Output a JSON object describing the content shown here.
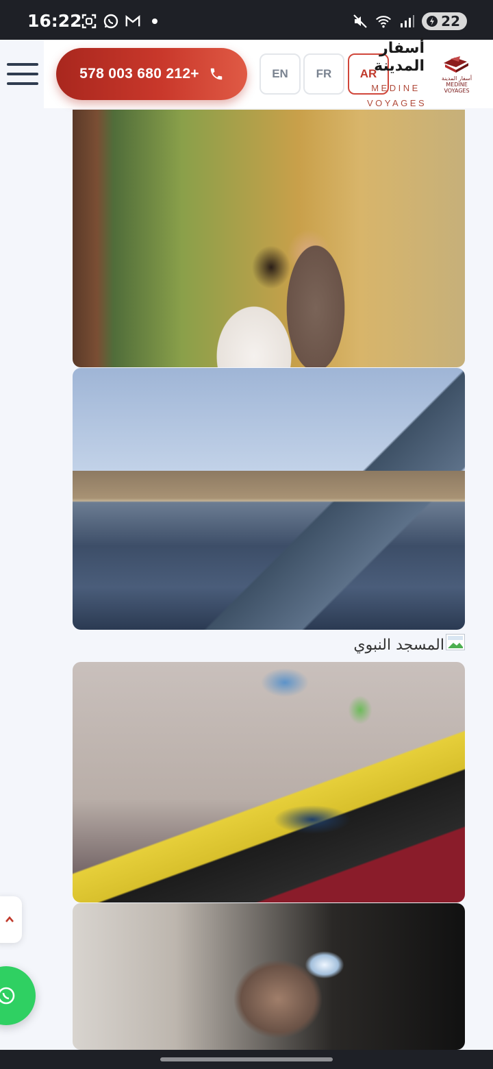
{
  "status_bar": {
    "time": "16:22",
    "battery": "22",
    "icons": [
      "screenshot-icon",
      "whatsapp-icon",
      "gmail-icon",
      "dot-icon",
      "mute-icon",
      "wifi-icon",
      "signal-icon",
      "battery-icon"
    ]
  },
  "header": {
    "phone_label": "578 003 680 212+",
    "languages": [
      {
        "code": "EN",
        "active": false
      },
      {
        "code": "FR",
        "active": false
      },
      {
        "code": "AR",
        "active": true
      }
    ],
    "brand_arabic": "أسفار المدينة",
    "brand_english": "MEDINE VOYAGES",
    "logo_caption_ar": "أسفار المدينة",
    "logo_caption_en": "MEDINE VOYAGES"
  },
  "gallery": {
    "caption": "المسجد النبوي"
  },
  "colors": {
    "accent_red": "#c0392b",
    "whatsapp_green": "#2fd062",
    "nav_dark": "#2f3c4f"
  }
}
